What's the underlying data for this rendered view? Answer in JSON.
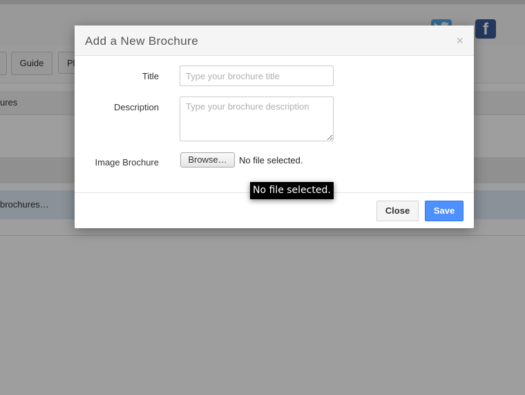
{
  "background": {
    "nav_buttons": [
      "",
      "Guide",
      "Pl"
    ],
    "table_header_text": "ures",
    "row_text": "brochures…",
    "social": {
      "twitter": "twitter-icon",
      "facebook_glyph": "f"
    }
  },
  "modal": {
    "title": "Add a New Brochure",
    "close_symbol": "×",
    "fields": {
      "title_label": "Title",
      "title_placeholder": "Type your brochure title",
      "description_label": "Description",
      "description_placeholder": "Type your brochure description",
      "image_label": "Image Brochure",
      "browse_label": "Browse…",
      "file_status": "No file selected."
    },
    "footer": {
      "close_label": "Close",
      "save_label": "Save"
    }
  },
  "tooltip": {
    "text": "No file selected."
  },
  "colors": {
    "save": "#4d90fe",
    "twitter": "#55acee",
    "facebook": "#3b5998",
    "overlay": "rgba(0,0,0,0.38)"
  }
}
